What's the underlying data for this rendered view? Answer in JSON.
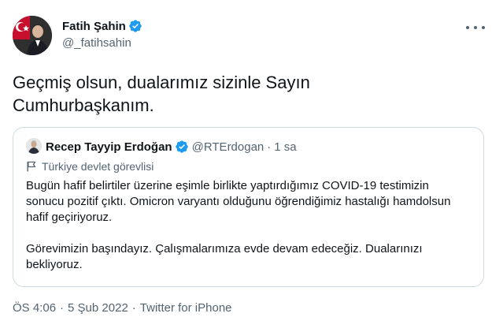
{
  "author": {
    "name": "Fatih Şahin",
    "handle": "@_fatihsahin"
  },
  "tweet": {
    "text_line1": "Geçmiş olsun, dualarımız sizinle Sayın",
    "text_line2": "Cumhurbaşkanım."
  },
  "quoted": {
    "name": "Recep Tayyip Erdoğan",
    "handle": "@RTErdogan",
    "separator": "·",
    "time": "1 sa",
    "label": "Türkiye devlet görevlisi",
    "paragraph1_line1": "Bugün hafif belirtiler üzerine eşimle birlikte yaptırdığımız COVID-19 testimizin",
    "paragraph1_line2": "sonucu pozitif çıktı. Omicron varyantı olduğunu öğrendiğimiz hastalığı hamdolsun",
    "paragraph1_line3": "hafif geçiriyoruz.",
    "paragraph2_line1": "Görevimizin başındayız. Çalışmalarımıza evde devam edeceğiz. Dualarınızı",
    "paragraph2_line2": "bekliyoruz."
  },
  "meta": {
    "time": "ÖS 4:06",
    "separator1": "·",
    "date": "5 Şub 2022",
    "separator2": "·",
    "source": "Twitter for iPhone"
  },
  "colors": {
    "text": "#0f1419",
    "secondary": "#536471",
    "border": "#cfd9de",
    "verified": "#1d9bf0"
  },
  "icons": {
    "verified": "verified-badge-icon",
    "more": "more-icon",
    "label": "flag-icon"
  }
}
